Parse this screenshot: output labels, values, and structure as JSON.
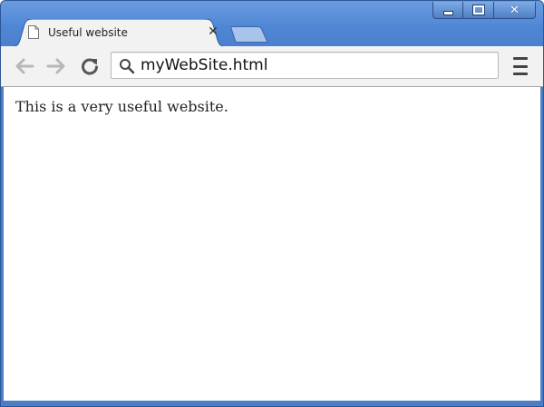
{
  "window": {
    "controls": {
      "minimize": "minimize",
      "maximize": "maximize",
      "close": "close"
    }
  },
  "tabs": [
    {
      "title": "Useful website",
      "icon": "page-icon",
      "active": true
    }
  ],
  "toolbar": {
    "back_icon": "arrow-left-icon",
    "forward_icon": "arrow-right-icon",
    "reload_icon": "reload-icon",
    "address": "myWebSite.html",
    "menu_icon": "hamburger-menu-icon"
  },
  "page": {
    "body_text": "This is a very useful website."
  },
  "colors": {
    "frame": "#4a7fc6",
    "toolbar": "#f2f2f2",
    "content": "#ffffff"
  }
}
